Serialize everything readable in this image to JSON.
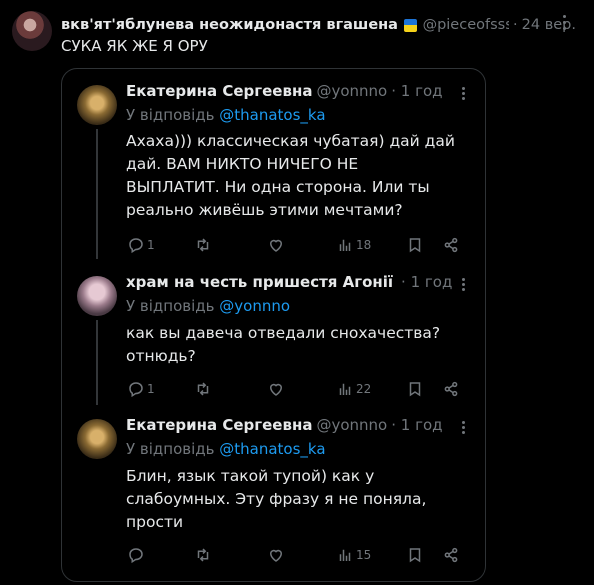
{
  "outer": {
    "author_name": "вкв'ят'яблунева неожидонастя вгашена",
    "handle": "@pieceofsssugar",
    "dot": "·",
    "date": "24 вер.",
    "text": "СУКА ЯК ЖЕ Я ОРУ",
    "flag_colors": [
      "#1d74d6",
      "#f5d21a"
    ]
  },
  "replies": [
    {
      "name": "Екатерина Сергеевна",
      "handle": "@yonnno",
      "time": "· 1 год",
      "replying_prefix": "У відповідь ",
      "mention": "@thanatos_ka",
      "lines": [
        "Ахаха))) классическая чубатая) дай дай",
        "дай. ВАМ НИКТО НИЧЕГО НЕ",
        "ВЫПЛАТИТ. Ни одна сторона. Или ты",
        "реально живёшь этими мечтами?"
      ],
      "reply_count": "1",
      "view_count": "18",
      "avatar_icon": "golden-trees-avatar"
    },
    {
      "name": "храм на честь пришестя Агонії",
      "handle": "",
      "time": "· 1 год",
      "replying_prefix": "У відповідь ",
      "mention": "@yonnno",
      "lines": [
        "как вы давеча отведали снохачества?",
        "отнюдь?"
      ],
      "reply_count": "1",
      "view_count": "22",
      "avatar_icon": "glasses-girl-avatar"
    },
    {
      "name": "Екатерина Сергеевна",
      "handle": "@yonnno",
      "time": "· 1 год",
      "replying_prefix": "У відповідь ",
      "mention": "@thanatos_ka",
      "lines": [
        "Блин, язык такой тупой) как у",
        "слабоумных. Эту фразу я не поняла,",
        "прости"
      ],
      "reply_count": "",
      "view_count": "15",
      "avatar_icon": "golden-trees-avatar"
    }
  ]
}
